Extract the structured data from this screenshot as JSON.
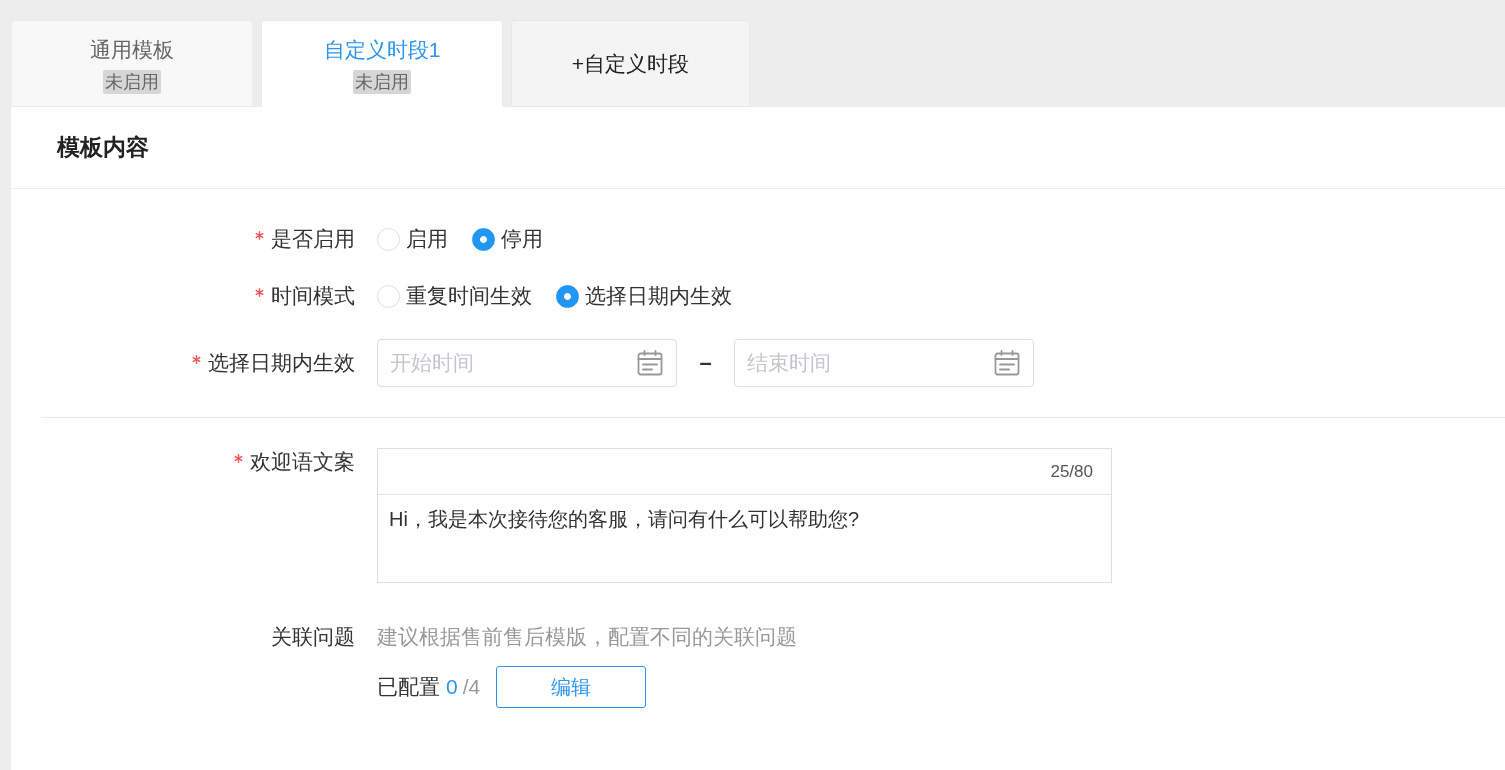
{
  "tabs": [
    {
      "kind": "template",
      "label": "通用模板",
      "status": "未启用",
      "selected": false
    },
    {
      "kind": "template",
      "label": "自定义时段1",
      "status": "未启用",
      "selected": true
    },
    {
      "kind": "add",
      "label": "+自定义时段",
      "selected": false
    }
  ],
  "panel": {
    "title": "模板内容",
    "fields": [
      {
        "kind": "radio",
        "label": "是否启用",
        "required": true,
        "options": [
          {
            "label": "启用",
            "selected": false
          },
          {
            "label": "停用",
            "selected": true
          }
        ]
      },
      {
        "kind": "radio",
        "label": "时间模式",
        "required": true,
        "options": [
          {
            "label": "重复时间生效",
            "selected": false
          },
          {
            "label": "选择日期内生效",
            "selected": true
          }
        ]
      },
      {
        "kind": "date_range",
        "label": "选择日期内生效",
        "required": true,
        "start": {
          "placeholder": "开始时间"
        },
        "separator": "–",
        "end": {
          "placeholder": "结束时间"
        }
      },
      {
        "kind": "divider"
      },
      {
        "kind": "textarea",
        "label": "欢迎语文案",
        "required": true,
        "counter": "25/80",
        "value": "Hi，我是本次接待您的客服，请问有什么可以帮助您?"
      },
      {
        "kind": "related",
        "label": "关联问题",
        "required": false,
        "hint": "建议根据售前售后模版，配置不同的关联问题",
        "configured": {
          "label": "已配置",
          "count": "0",
          "total": "/4"
        },
        "button": "编辑"
      }
    ]
  }
}
